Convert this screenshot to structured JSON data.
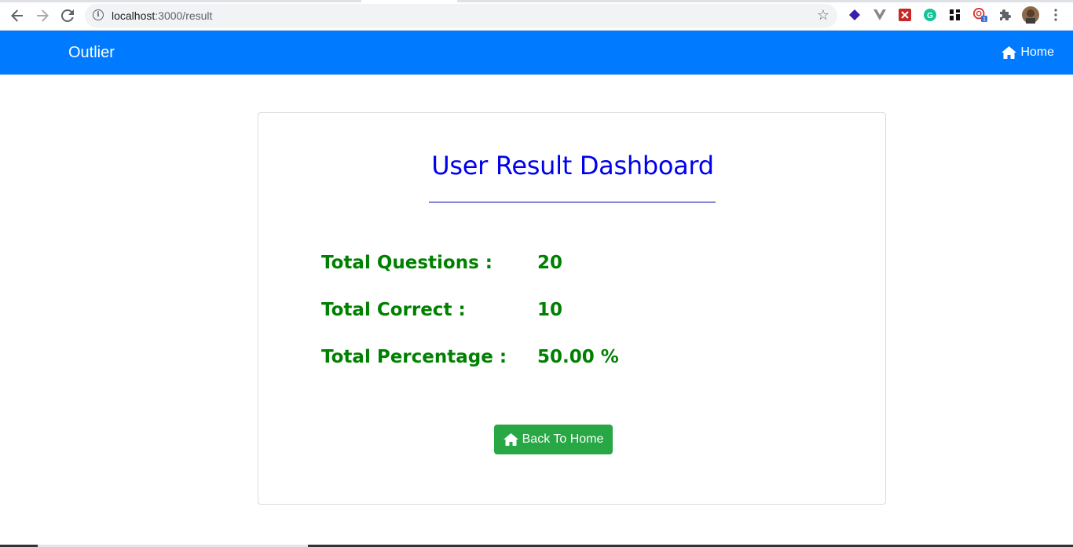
{
  "browser": {
    "url_host": "localhost",
    "url_path": ":3000/result",
    "extensions": [
      "layers-icon",
      "vue-icon",
      "devtools-icon",
      "grammarly-icon",
      "qr-icon",
      "lastpass-icon",
      "puzzle-icon",
      "avatar"
    ],
    "badge_count": "1"
  },
  "navbar": {
    "brand": "Outlier",
    "home_label": "Home",
    "color": "#007bff"
  },
  "dashboard": {
    "title": "User Result Dashboard",
    "stats": [
      {
        "label": "Total Questions :",
        "value": "20"
      },
      {
        "label": "Total Correct :",
        "value": "10"
      },
      {
        "label": "Total Percentage :",
        "value": "50.00 %"
      }
    ],
    "back_button_label": "Back To Home",
    "title_color": "#0000ee",
    "stat_color": "#008000",
    "button_color": "#28a745"
  }
}
